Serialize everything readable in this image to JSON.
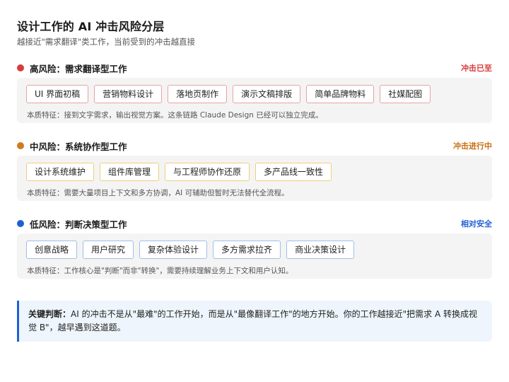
{
  "header": {
    "title": "设计工作的 AI 冲击风险分层",
    "subtitle": "越接近\"需求翻译\"类工作，当前受到的冲击越直接"
  },
  "tiers": [
    {
      "title": "高风险：需求翻译型工作",
      "status": "冲击已至",
      "chips": [
        "UI 界面初稿",
        "营销物料设计",
        "落地页制作",
        "演示文稿排版",
        "简单品牌物料",
        "社媒配图"
      ],
      "note": "本质特征：接到文字需求，输出视觉方案。这条链路 Claude Design 已经可以独立完成。",
      "color": "#d83b3b"
    },
    {
      "title": "中风险：系统协作型工作",
      "status": "冲击进行中",
      "chips": [
        "设计系统维护",
        "组件库管理",
        "与工程师协作还原",
        "多产品线一致性"
      ],
      "note": "本质特征：需要大量项目上下文和多方协调，AI 可辅助但暂时无法替代全流程。",
      "color": "#d17a1e"
    },
    {
      "title": "低风险：判断决策型工作",
      "status": "相对安全",
      "chips": [
        "创意战略",
        "用户研究",
        "复杂体验设计",
        "多方需求拉齐",
        "商业决策设计"
      ],
      "note": "本质特征：工作核心是\"判断\"而非\"转换\"，需要持续理解业务上下文和用户认知。",
      "color": "#1f5fd6"
    }
  ],
  "callout": {
    "label": "关键判断：",
    "text": "AI 的冲击不是从\"最难\"的工作开始，而是从\"最像翻译工作\"的地方开始。你的工作越接近\"把需求 A 转换成视觉 B\"，越早遇到这道题。"
  }
}
